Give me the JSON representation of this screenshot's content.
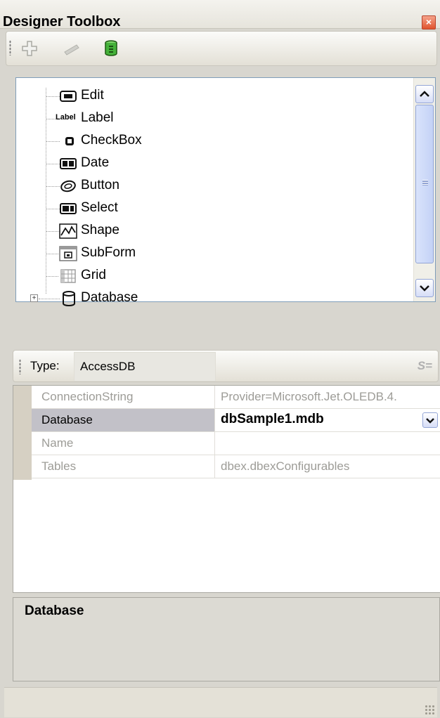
{
  "window": {
    "title": "Designer Toolbox",
    "close_glyph": "×"
  },
  "toolbar": {
    "buttons": [
      {
        "name": "add",
        "icon": "add-icon",
        "enabled": false
      },
      {
        "name": "remove",
        "icon": "remove-icon",
        "enabled": false
      },
      {
        "name": "database",
        "icon": "database-icon",
        "enabled": true
      }
    ]
  },
  "tree": {
    "items": [
      {
        "label": "Edit",
        "icon": "edit-control-icon"
      },
      {
        "label": "Label",
        "icon": "label-control-icon",
        "icon_text": "Label"
      },
      {
        "label": "CheckBox",
        "icon": "checkbox-control-icon"
      },
      {
        "label": "Date",
        "icon": "date-control-icon"
      },
      {
        "label": "Button",
        "icon": "button-control-icon"
      },
      {
        "label": "Select",
        "icon": "select-control-icon"
      },
      {
        "label": "Shape",
        "icon": "shape-control-icon"
      },
      {
        "label": "SubForm",
        "icon": "subform-control-icon"
      },
      {
        "label": "Grid",
        "icon": "grid-control-icon"
      },
      {
        "label": "Database",
        "icon": "database-node-icon",
        "expander": "+"
      }
    ]
  },
  "type_bar": {
    "label": "Type:",
    "value": "AccessDB",
    "icon_glyph": "S="
  },
  "properties": [
    {
      "name": "ConnectionString",
      "value": "Provider=Microsoft.Jet.OLEDB.4.",
      "enabled": false
    },
    {
      "name": "Database",
      "value": "dbSample1.mdb",
      "enabled": true,
      "selected": true
    },
    {
      "name": "Name",
      "value": "",
      "enabled": false
    },
    {
      "name": "Tables",
      "value": "dbex.dbexConfigurables",
      "enabled": false
    }
  ],
  "description": {
    "title": "Database"
  },
  "colors": {
    "accent": "#93a5d6",
    "selection": "#c2c1c8",
    "disabled_text": "#9d9c97"
  }
}
